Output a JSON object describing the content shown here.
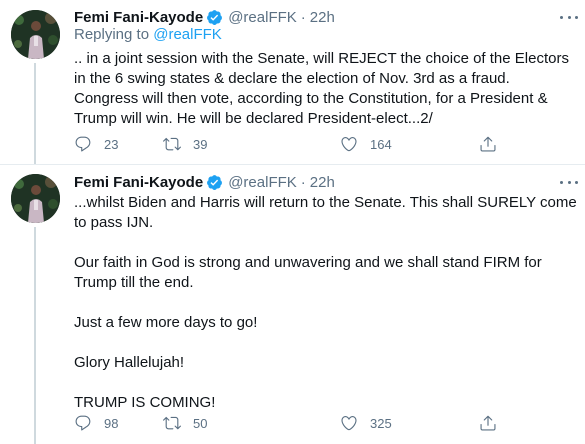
{
  "tweets": [
    {
      "author_name": "Femi Fani-Kayode",
      "handle": "@realFFK",
      "separator": "·",
      "time": "22h",
      "replying_to_prefix": "Replying to ",
      "replying_to_handle": "@realFFK",
      "text": ".. in a joint session with the Senate, will REJECT the choice of the Electors in the 6 swing states & declare the election of Nov. 3rd as a fraud. Congress will then vote, according to the Constitution, for a President & Trump will win. He will be declared President-elect...2/",
      "replies": "23",
      "retweets": "39",
      "likes": "164"
    },
    {
      "author_name": "Femi Fani-Kayode",
      "handle": "@realFFK",
      "separator": "·",
      "time": "22h",
      "paragraphs": [
        "...whilst Biden and Harris will return to the Senate. This shall SURELY come to pass IJN.",
        "Our faith in God is strong and unwavering and we shall stand FIRM for Trump till the end.",
        "Just a few more days to go!",
        "Glory Hallelujah!",
        "TRUMP IS COMING!"
      ],
      "replies": "98",
      "retweets": "50",
      "likes": "325"
    }
  ],
  "icons": {
    "verified": "verified-badge-icon",
    "reply": "reply-icon",
    "retweet": "retweet-icon",
    "like": "heart-icon",
    "share": "share-icon",
    "more": "more-icon"
  },
  "colors": {
    "accent": "#1da1f2",
    "secondary_text": "#5b7083",
    "primary_text": "#0f1419",
    "divider": "#e6ecf0"
  }
}
